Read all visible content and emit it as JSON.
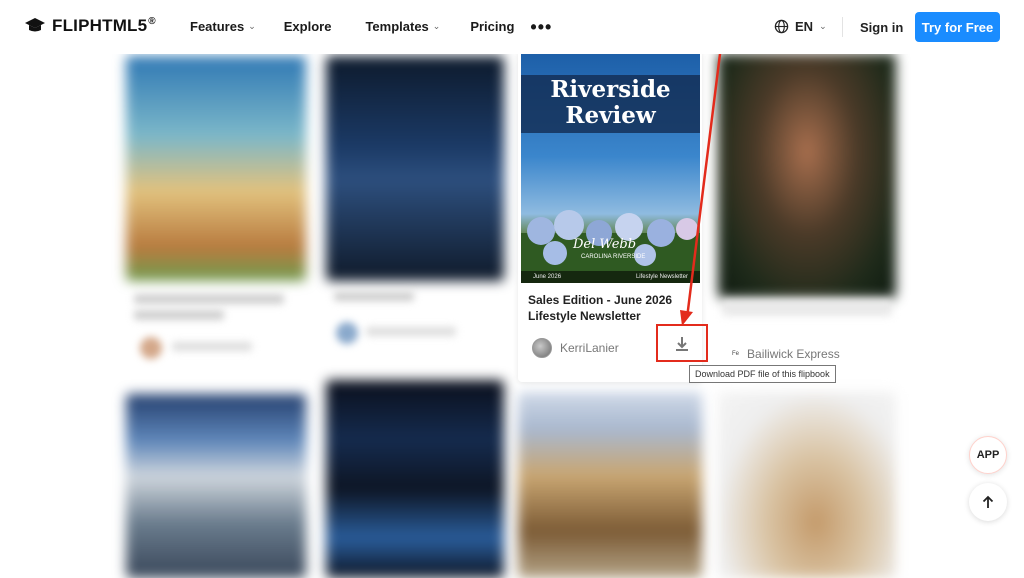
{
  "header": {
    "logo_text": "FLIPHTML5",
    "logo_reg": "®",
    "nav": [
      {
        "label": "Features",
        "has_chevron": true
      },
      {
        "label": "Explore",
        "has_chevron": false
      },
      {
        "label": "Templates",
        "has_chevron": true
      },
      {
        "label": "Pricing",
        "has_chevron": false
      }
    ],
    "more": "•••",
    "language": "EN",
    "sign_in": "Sign in",
    "cta": "Try for Free"
  },
  "featured_card": {
    "cover_title_line1": "Riverside",
    "cover_title_line2": "Review",
    "cover_signature": "Del Webb",
    "cover_subtitle": "CAROLINA RIVERSIDE",
    "cover_footer_left": "June 2026",
    "cover_footer_right": "Lifestyle Newsletter",
    "title": "Sales Edition - June 2026 Lifestyle Newsletter",
    "author": "KerriLanier"
  },
  "tooltip": "Download PDF file of this flipbook",
  "neighbor_card": {
    "publisher": "Bailiwick Express",
    "publisher_prefix": "Fe"
  },
  "floating": {
    "app": "APP"
  },
  "colors": {
    "cta": "#1a8cff",
    "highlight": "#e32b1c"
  }
}
